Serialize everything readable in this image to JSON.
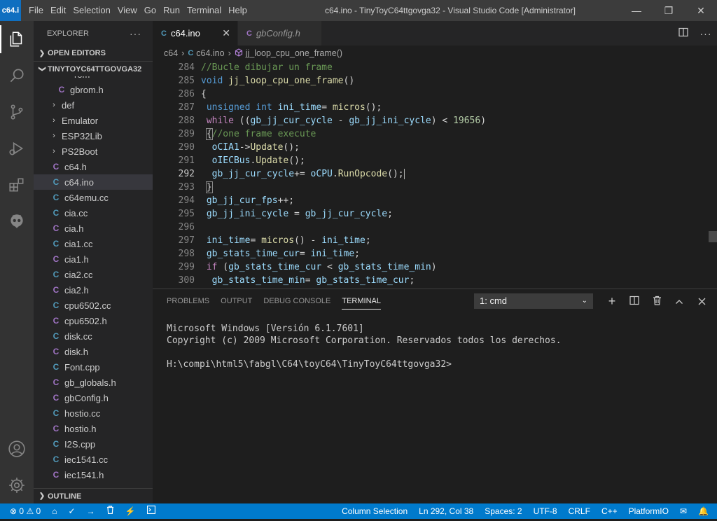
{
  "titlebar": {
    "app_icon": "c64.i",
    "menu": [
      "File",
      "Edit",
      "Selection",
      "View",
      "Go",
      "Run",
      "Terminal",
      "Help"
    ],
    "title": "c64.ino - TinyToyC64ttgovga32 - Visual Studio Code [Administrator]",
    "controls": {
      "minimize": "—",
      "maximize": "❐",
      "close": "✕"
    }
  },
  "activitybar": {
    "icons": [
      "explorer-icon",
      "search-icon",
      "source-control-icon",
      "run-debug-icon",
      "extensions-icon",
      "platformio-icon"
    ],
    "bottom_icons": [
      "account-icon",
      "settings-gear-icon"
    ]
  },
  "sidebar": {
    "header": "EXPLORER",
    "more": "···",
    "open_editors": "OPEN EDITORS",
    "project": "TINYTOYC64TTGOVGA32",
    "partial_item": "rom",
    "items": [
      {
        "name": "gbrom.h",
        "type": "c",
        "indent": 2
      },
      {
        "name": "def",
        "type": "folder"
      },
      {
        "name": "Emulator",
        "type": "folder"
      },
      {
        "name": "ESP32Lib",
        "type": "folder"
      },
      {
        "name": "PS2Boot",
        "type": "folder"
      },
      {
        "name": "c64.h",
        "type": "c"
      },
      {
        "name": "c64.ino",
        "type": "cpp",
        "selected": true
      },
      {
        "name": "c64emu.cc",
        "type": "cpp"
      },
      {
        "name": "cia.cc",
        "type": "cpp"
      },
      {
        "name": "cia.h",
        "type": "c"
      },
      {
        "name": "cia1.cc",
        "type": "cpp"
      },
      {
        "name": "cia1.h",
        "type": "c"
      },
      {
        "name": "cia2.cc",
        "type": "cpp"
      },
      {
        "name": "cia2.h",
        "type": "c"
      },
      {
        "name": "cpu6502.cc",
        "type": "cpp"
      },
      {
        "name": "cpu6502.h",
        "type": "c"
      },
      {
        "name": "disk.cc",
        "type": "cpp"
      },
      {
        "name": "disk.h",
        "type": "c"
      },
      {
        "name": "Font.cpp",
        "type": "cpp"
      },
      {
        "name": "gb_globals.h",
        "type": "c"
      },
      {
        "name": "gbConfig.h",
        "type": "c"
      },
      {
        "name": "hostio.cc",
        "type": "cpp"
      },
      {
        "name": "hostio.h",
        "type": "c"
      },
      {
        "name": "I2S.cpp",
        "type": "cpp"
      },
      {
        "name": "iec1541.cc",
        "type": "cpp"
      },
      {
        "name": "iec1541.h",
        "type": "c"
      }
    ],
    "outline": "OUTLINE"
  },
  "tabs": [
    {
      "label": "c64.ino",
      "icon": "C",
      "active": true,
      "close": "✕"
    },
    {
      "label": "gbConfig.h",
      "icon": "C",
      "active": false
    }
  ],
  "breadcrumbs": {
    "folder": "c64",
    "file": "c64.ino",
    "symbol": "jj_loop_cpu_one_frame()"
  },
  "editor": {
    "current_line": 292,
    "lines": [
      {
        "n": 284,
        "html": "<span class=\"cm\">//Bucle dibujar un frame</span>"
      },
      {
        "n": 285,
        "html": "<span class=\"kw\">void</span> <span class=\"fn\">jj_loop_cpu_one_frame</span>()"
      },
      {
        "n": 286,
        "html": "{"
      },
      {
        "n": 287,
        "html": " <span class=\"kw\">unsigned</span> <span class=\"kw\">int</span> <span class=\"vr\">ini_time</span>= <span class=\"fn\">micros</span>();"
      },
      {
        "n": 288,
        "html": " <span class=\"ctl\">while</span> ((<span class=\"vr\">gb_jj_cur_cycle</span> - <span class=\"vr\">gb_jj_ini_cycle</span>) &lt; <span class=\"num\">19656</span>)"
      },
      {
        "n": 289,
        "html": " <span class=\"bm\">{</span><span class=\"cm\">//one frame execute</span>"
      },
      {
        "n": 290,
        "html": "  <span class=\"vr\">oCIA1</span>-&gt;<span class=\"fn\">Update</span>();"
      },
      {
        "n": 291,
        "html": "  <span class=\"vr\">oIECBus</span>.<span class=\"fn\">Update</span>();"
      },
      {
        "n": 292,
        "html": "  <span class=\"vr\">gb_jj_cur_cycle</span>+= <span class=\"vr\">oCPU</span>.<span class=\"fn\">RunOpcode</span>();<span style=\"border-left:1px solid #aeafad\"></span>"
      },
      {
        "n": 293,
        "html": " <span class=\"bm\">}</span>"
      },
      {
        "n": 294,
        "html": " <span class=\"vr\">gb_jj_cur_fps</span>++;"
      },
      {
        "n": 295,
        "html": " <span class=\"vr\">gb_jj_ini_cycle</span> = <span class=\"vr\">gb_jj_cur_cycle</span>;"
      },
      {
        "n": 296,
        "html": ""
      },
      {
        "n": 297,
        "html": " <span class=\"vr\">ini_time</span>= <span class=\"fn\">micros</span>() - <span class=\"vr\">ini_time</span>;"
      },
      {
        "n": 298,
        "html": " <span class=\"vr\">gb_stats_time_cur</span>= <span class=\"vr\">ini_time</span>;"
      },
      {
        "n": 299,
        "html": " <span class=\"ctl\">if</span> (<span class=\"vr\">gb_stats_time_cur</span> &lt; <span class=\"vr\">gb_stats_time_min</span>)"
      },
      {
        "n": 300,
        "html": "  <span class=\"vr\">gb_stats_time_min</span>= <span class=\"vr\">gb_stats_time_cur</span>;"
      }
    ]
  },
  "panel": {
    "tabs": [
      "PROBLEMS",
      "OUTPUT",
      "DEBUG CONSOLE",
      "TERMINAL"
    ],
    "active_tab": "TERMINAL",
    "terminal_select": "1: cmd",
    "actions": [
      "+",
      "◫",
      "🗑",
      "⌃",
      "✕"
    ],
    "terminal_lines": [
      "Microsoft Windows [Versión 6.1.7601]",
      "Copyright (c) 2009 Microsoft Corporation. Reservados todos los derechos.",
      "",
      "H:\\compi\\html5\\fabgl\\C64\\toyC64\\TinyToyC64ttgovga32>"
    ]
  },
  "statusbar": {
    "errors": "0",
    "warnings": "0",
    "left_icons": [
      "home-icon",
      "check-icon",
      "arrow-right-icon",
      "trash-icon",
      "plug-icon",
      "terminal-icon"
    ],
    "column_selection": "Column Selection",
    "position": "Ln 292, Col 38",
    "spaces": "Spaces: 2",
    "encoding": "UTF-8",
    "eol": "CRLF",
    "language": "C++",
    "platform": "PlatformIO"
  }
}
